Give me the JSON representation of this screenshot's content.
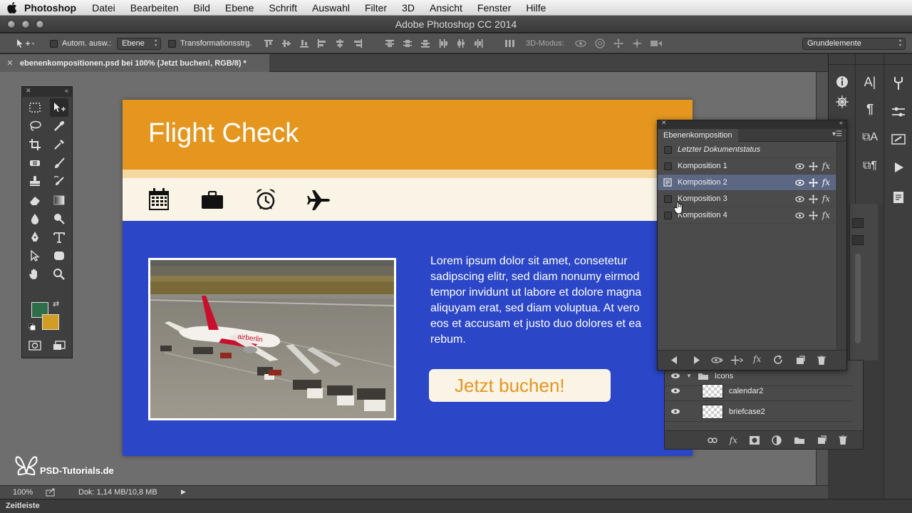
{
  "menubar": {
    "app_name": "Photoshop",
    "items": [
      "Datei",
      "Bearbeiten",
      "Bild",
      "Ebene",
      "Schrift",
      "Auswahl",
      "Filter",
      "3D",
      "Ansicht",
      "Fenster",
      "Hilfe"
    ]
  },
  "window": {
    "title": "Adobe Photoshop CC 2014"
  },
  "options_bar": {
    "auto_select_label": "Autom. ausw.:",
    "auto_select_value": "Ebene",
    "transform_label": "Transformationsstrg.",
    "mode_3d_label": "3D-Modus:",
    "workspace_value": "Grundelemente"
  },
  "document_tab": {
    "label": "ebenenkompositionen.psd bei 100% (Jetzt buchen!, RGB/8) *"
  },
  "canvas": {
    "title": "Flight Check",
    "body_text": "Lorem ipsum dolor sit amet, consetetur sadipscing elitr, sed diam nonumy eirmod tempor invidunt ut labore et dolore magna aliquyam erat, sed diam voluptua. At vero eos et accusam et justo duo dolores et ea rebum.",
    "button_label": "Jetzt buchen!",
    "airline_text": "airberlin",
    "colors": {
      "header": "#e4961f",
      "body": "#2b46c7",
      "iconbar": "#faf4e6"
    }
  },
  "layer_comps": {
    "tab_label": "Ebenenkomposition",
    "last_state": "Letzter Dokumentstatus",
    "items": [
      {
        "name": "Komposition 1"
      },
      {
        "name": "Komposition 2"
      },
      {
        "name": "Komposition 3"
      },
      {
        "name": "Komposition 4"
      }
    ]
  },
  "layers": {
    "group_name": "Icons",
    "items": [
      "calendar2",
      "briefcase2"
    ]
  },
  "status": {
    "zoom": "100%",
    "doc_size": "Dok: 1,14 MB/10,8 MB"
  },
  "timeline": {
    "label": "Zeitleiste"
  },
  "watermark": {
    "text": "PSD-Tutorials.de"
  }
}
